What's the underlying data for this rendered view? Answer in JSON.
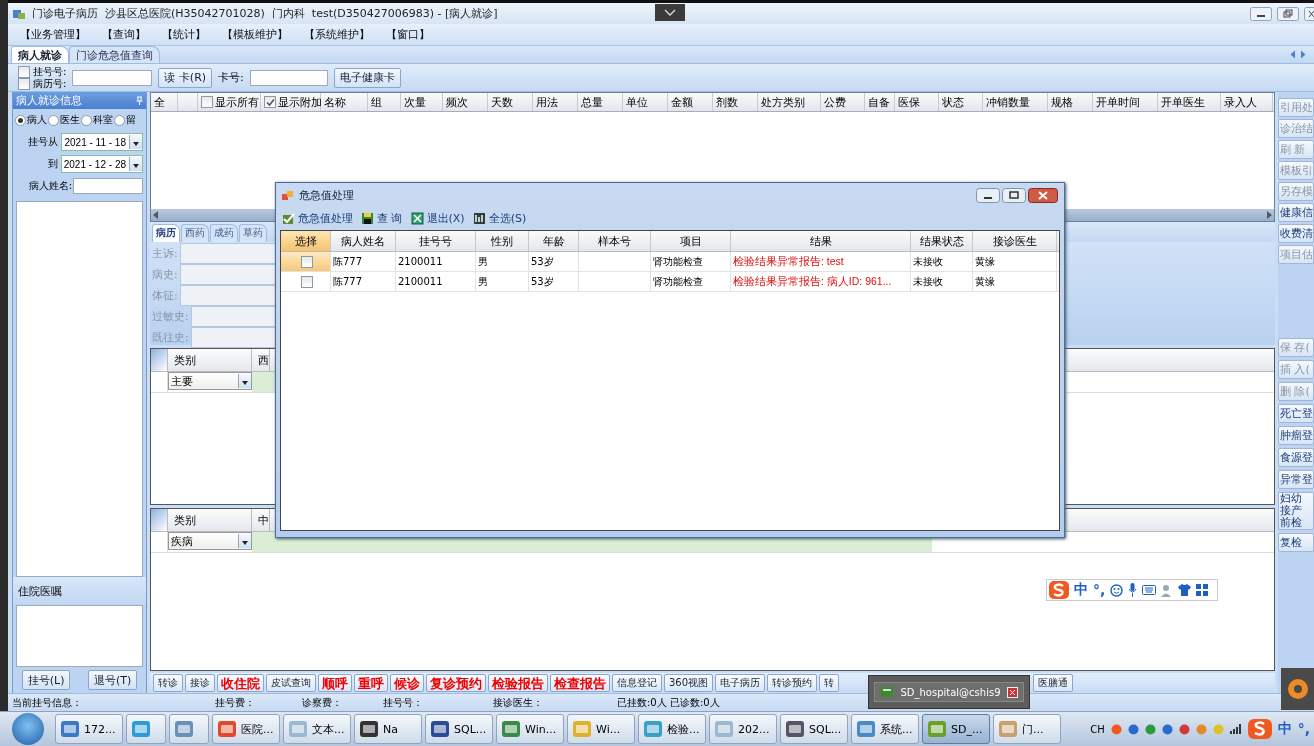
{
  "window": {
    "title": "门诊电子病历  沙县区总医院(H35042701028)  门内科  test(D350427006983) - [病人就诊]"
  },
  "menu": [
    "【业务管理】",
    "【查询】",
    "【统计】",
    "【模板维护】",
    "【系统维护】",
    "【窗口】"
  ],
  "tabs": [
    {
      "label": "病人就诊",
      "selected": true
    },
    {
      "label": "门诊危急值查询",
      "selected": false
    }
  ],
  "search_bar": {
    "checks": [
      {
        "label": "挂号号:",
        "checked": false
      },
      {
        "label": "病历号:",
        "checked": false
      }
    ],
    "read_card_button": "读 卡(R)",
    "card_label": "卡号:",
    "health_card_button": "电子健康卡"
  },
  "left_panel": {
    "title": "病人就诊信息",
    "filters": [
      {
        "label": "病人",
        "selected": true
      },
      {
        "label": "医生",
        "selected": false
      },
      {
        "label": "科室",
        "selected": false
      },
      {
        "label": "留",
        "selected": false
      }
    ],
    "date_from_label": "挂号从",
    "date_from": "2021 - 11 - 18",
    "date_to_label": "到",
    "date_to": "2021 - 12 - 28",
    "name_label": "病人姓名:",
    "inpatient_title": "住院医嘱",
    "buttons": [
      "挂号(L)",
      "退号(T)"
    ]
  },
  "order_grid": {
    "select_all": "全",
    "header_checks": [
      {
        "label": "显示所有",
        "checked": false
      },
      {
        "label": "显示附加",
        "checked": true
      }
    ],
    "columns": [
      "名称",
      "组",
      "次量",
      "频次",
      "天数",
      "用法",
      "总量",
      "单位",
      "金额",
      "剂数",
      "处方类别",
      "公费",
      "自备",
      "医保",
      "状态",
      "冲销数量",
      "规格",
      "开单时间",
      "开单医生",
      "录入人"
    ]
  },
  "record_tabs": [
    {
      "label": "病历",
      "selected": true
    },
    {
      "label": "西药",
      "selected": false
    },
    {
      "label": "成药",
      "selected": false
    },
    {
      "label": "草药",
      "selected": false
    }
  ],
  "record_fields": [
    "主诉:",
    "病史:",
    "体征:",
    "过敏史:",
    "既往史:"
  ],
  "diagnosis_grids": [
    {
      "columns": [
        "类别",
        "西"
      ],
      "type_value": "主要"
    },
    {
      "columns": [
        "类别",
        "中"
      ],
      "type_value": "疾病"
    }
  ],
  "action_buttons": [
    {
      "label": "转诊",
      "kind": "plain"
    },
    {
      "label": "接诊",
      "kind": "plain"
    },
    {
      "label": "收住院",
      "kind": "alert"
    },
    {
      "label": "皮试查询",
      "kind": "plain"
    },
    {
      "label": "顺呼",
      "kind": "alert"
    },
    {
      "label": "重呼",
      "kind": "alert"
    },
    {
      "label": "候诊",
      "kind": "alert"
    },
    {
      "label": "复诊预约",
      "kind": "alert"
    },
    {
      "label": "检验报告",
      "kind": "alert"
    },
    {
      "label": "检查报告",
      "kind": "alert"
    },
    {
      "label": "信息登记",
      "kind": "plain"
    },
    {
      "label": "360视图",
      "kind": "plain"
    },
    {
      "label": "电子病历",
      "kind": "plain"
    },
    {
      "label": "转诊预约",
      "kind": "plain"
    },
    {
      "label": "转",
      "kind": "cut"
    },
    {
      "label": "医膳通",
      "kind": "plain"
    }
  ],
  "right_toolbar": {
    "top": [
      {
        "label": "引用处",
        "disabled": true
      },
      {
        "label": "诊治结",
        "disabled": true
      },
      {
        "label": "刷 新",
        "disabled": true
      },
      {
        "label": "模板引",
        "disabled": true
      },
      {
        "label": "另存模",
        "disabled": true
      },
      {
        "label": "健康信",
        "disabled": false
      },
      {
        "label": "收费清",
        "disabled": false
      },
      {
        "label": "项目估",
        "disabled": true
      }
    ],
    "bottom": [
      {
        "label": "保 存(",
        "disabled": true
      },
      {
        "label": "插 入(",
        "disabled": true
      },
      {
        "label": "删 除(",
        "disabled": true
      },
      {
        "label": "死亡登",
        "disabled": false
      },
      {
        "label": "肿瘤登",
        "disabled": false
      },
      {
        "label": "食源登",
        "disabled": false
      },
      {
        "label": "异常登",
        "disabled": false
      },
      {
        "label": "妇幼接产前检",
        "disabled": false
      },
      {
        "label": "复检",
        "disabled": false
      }
    ]
  },
  "status_bar": [
    "当前挂号信息：",
    "挂号费：",
    "诊察费：",
    "挂号号：",
    "接诊医生：",
    "已挂数:0人",
    "已诊数:0人"
  ],
  "dialog": {
    "title": "危急值处理",
    "toolbar": [
      "危急值处理",
      "查 询",
      "退出(X)",
      "全选(S)"
    ],
    "columns": [
      "选择",
      "病人姓名",
      "挂号号",
      "性别",
      "年龄",
      "样本号",
      "项目",
      "结果",
      "结果状态",
      "接诊医生"
    ],
    "rows": [
      {
        "selected": true,
        "checked": false,
        "cells": [
          "",
          "陈777",
          "2100011",
          "男",
          "53岁",
          "",
          "肾功能检查",
          "检验结果异常报告: test",
          "未接收",
          "黄缘"
        ]
      },
      {
        "selected": false,
        "checked": false,
        "cells": [
          "",
          "陈777",
          "2100011",
          "男",
          "53岁",
          "",
          "肾功能检查",
          "检验结果异常报告: 病人ID: 961...",
          "未接收",
          "黄缘"
        ]
      }
    ]
  },
  "notification": {
    "label": "SD_hospital@cshis9"
  },
  "ime_bar": {
    "labels": [
      "中",
      "°,"
    ]
  },
  "taskbar": {
    "items": [
      {
        "label": "172...",
        "selected": false
      },
      {
        "selected": false
      },
      {
        "selected": false
      },
      {
        "label": "医院...",
        "selected": false
      },
      {
        "label": "文本...",
        "selected": false
      },
      {
        "label": "Na",
        "selected": false
      },
      {
        "label": "SQL...",
        "selected": false
      },
      {
        "label": "Win...",
        "selected": false
      },
      {
        "label": "Wi...",
        "selected": false
      },
      {
        "label": "检验...",
        "selected": false
      },
      {
        "label": "202...",
        "selected": false
      },
      {
        "label": "SQL...",
        "selected": false
      },
      {
        "label": "系统...",
        "selected": false
      },
      {
        "label": "SD_...",
        "selected": true
      },
      {
        "label": "门...",
        "selected": false
      }
    ],
    "tray": {
      "lang": "CH",
      "ime": [
        "中",
        "°,"
      ]
    }
  }
}
